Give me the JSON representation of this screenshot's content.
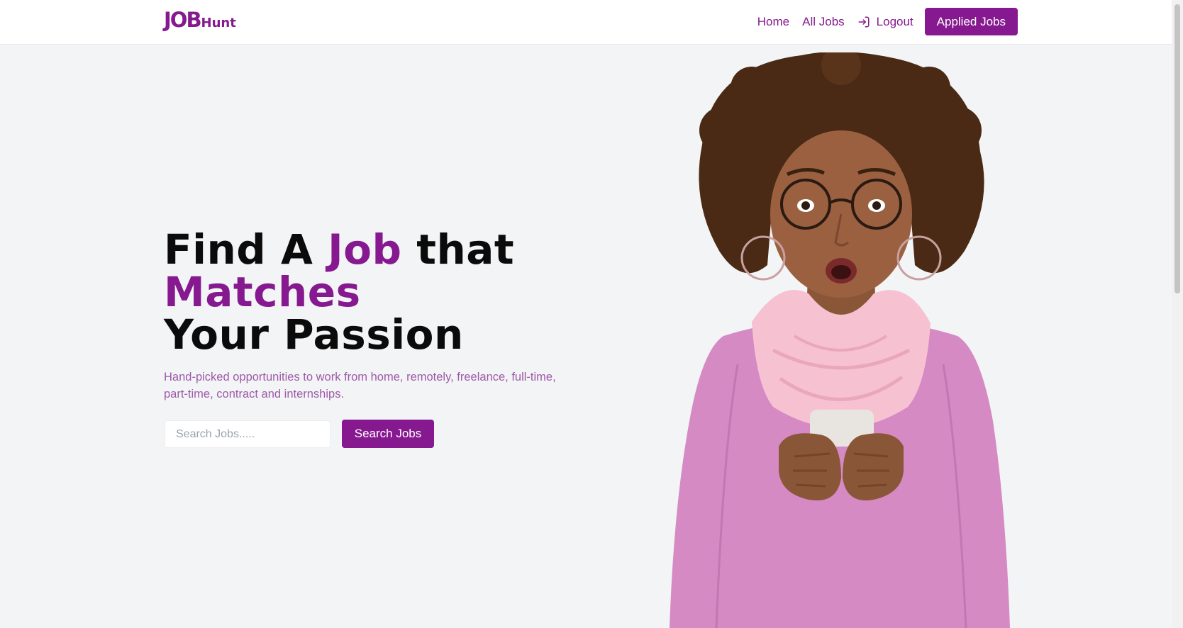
{
  "brand": {
    "logo_main": "JOB",
    "logo_suffix": "Hunt",
    "accent_color": "#86198f"
  },
  "nav": {
    "links": [
      "Home",
      "All Jobs"
    ],
    "logout_label": "Logout",
    "logout_icon": "logout-icon",
    "applied_button": "Applied Jobs"
  },
  "hero": {
    "title_part1": "Find A ",
    "title_accent1": "Job",
    "title_part2": " that",
    "title_accent2": "Matches",
    "title_line3": "Your Passion",
    "subtitle": "Hand-picked opportunities to work from home, remotely, freelance, full-time, part-time, contract and internships.",
    "search_placeholder": "Search Jobs.....",
    "search_button": "Search Jobs",
    "image": "surprised-woman-holding-phone"
  }
}
